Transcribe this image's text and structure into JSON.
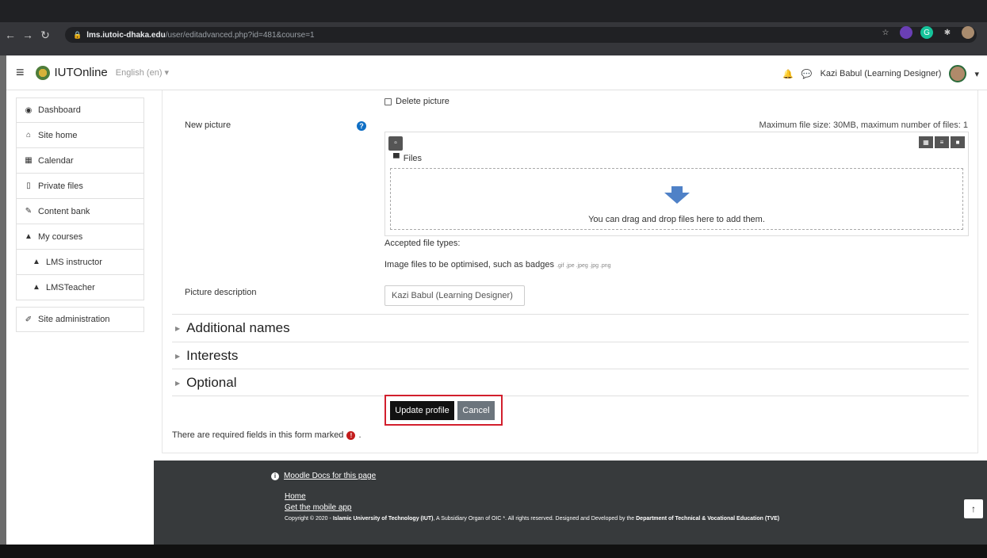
{
  "browser": {
    "url_host": "lms.iutoic-dhaka.edu",
    "url_path": "/user/editadvanced.php?id=481&course=1"
  },
  "navbar": {
    "brand": "IUTOnline",
    "language": "English (en) ▾",
    "user_name": "Kazi Babul (Learning Designer)"
  },
  "sidebar": {
    "items": [
      {
        "label": "Dashboard",
        "icon": "dashboard-icon",
        "glyph": "◉"
      },
      {
        "label": "Site home",
        "icon": "home-icon",
        "glyph": "⌂"
      },
      {
        "label": "Calendar",
        "icon": "calendar-icon",
        "glyph": "▦"
      },
      {
        "label": "Private files",
        "icon": "file-icon",
        "glyph": "▯"
      },
      {
        "label": "Content bank",
        "icon": "brush-icon",
        "glyph": "✎"
      },
      {
        "label": "My courses",
        "icon": "graduation-cap-icon",
        "glyph": "▲"
      },
      {
        "label": "LMS instructor",
        "icon": "graduation-cap-icon",
        "glyph": "▲"
      },
      {
        "label": "LMSTeacher",
        "icon": "graduation-cap-icon",
        "glyph": "▲"
      }
    ],
    "admin": {
      "label": "Site administration",
      "icon": "wrench-icon",
      "glyph": "✐"
    }
  },
  "form": {
    "delete_picture_label": "Delete picture",
    "new_picture_label": "New picture",
    "max_size_text": "Maximum file size: 30MB, maximum number of files: 1",
    "files_label": "Files",
    "drop_text": "You can drag and drop files here to add them.",
    "accepted_label": "Accepted file types:",
    "accepted_desc": "Image files to be optimised, such as badges",
    "accepted_exts": ".gif .jpe .jpeg .jpg .png",
    "picture_description_label": "Picture description",
    "picture_description_value": "Kazi Babul (Learning Designer)",
    "sections": [
      "Additional names",
      "Interests",
      "Optional"
    ],
    "update_button": "Update profile",
    "cancel_button": "Cancel",
    "required_note": "There are required fields in this form marked",
    "required_note_suffix": "."
  },
  "footer": {
    "docs_link": "Moodle Docs for this page",
    "home_link": "Home",
    "app_link": "Get the mobile app",
    "copyright_1": "Copyright © 2020 - ",
    "copyright_org": "Islamic University of Technology (IUT)",
    "copyright_2": ", A Subsidiary Organ of OIC *. All rights reserved. Designed and Developed by the ",
    "copyright_dept": "Department of Technical & Vocational Education (TVE)"
  },
  "colors": {
    "highlight": "#d21f2d",
    "help": "#0f6fc5",
    "footer": "#373a3c"
  }
}
